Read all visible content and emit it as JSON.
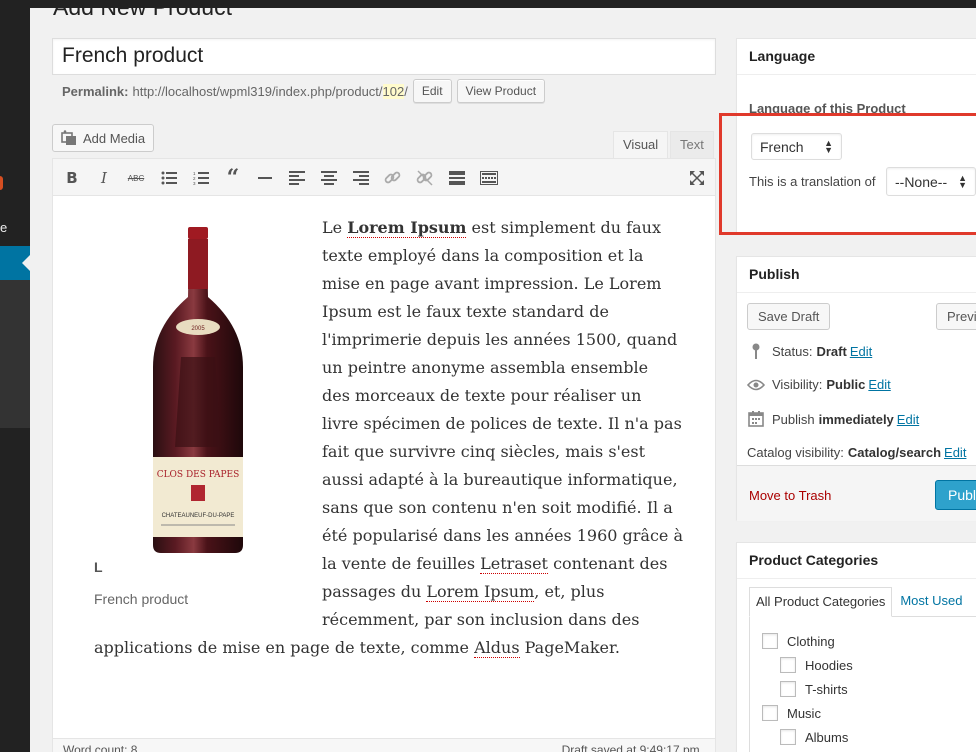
{
  "page": {
    "heading": "Add New Product"
  },
  "title": {
    "value": "French product"
  },
  "permalink": {
    "label": "Permalink:",
    "base": "http://localhost/wpml319/index.php/product/",
    "slug": "102",
    "trail": "/",
    "edit_label": "Edit",
    "view_label": "View Product"
  },
  "editor": {
    "add_media_label": "Add Media",
    "tab_visual": "Visual",
    "tab_text": "Text",
    "toolbar": [
      "bold",
      "italic",
      "strikethrough",
      "bullet-list",
      "numbered-list",
      "blockquote",
      "horizontal-rule",
      "align-left",
      "align-center",
      "align-right",
      "link",
      "unlink",
      "read-more",
      "toolbar-toggle",
      "fullscreen"
    ],
    "caption_letter": "L",
    "caption": "French product",
    "lines": [
      [
        "Le ",
        "Lorem Ipsum",
        " est simplement du faux"
      ],
      "texte employé dans la composition et la",
      "mise en page avant impression. Le Lorem",
      "Ipsum est le faux texte standard de",
      "l'imprimerie depuis les années 1500, quand",
      "un peintre anonyme assembla ensemble",
      "des morceaux de texte pour réaliser un",
      "livre spécimen de polices de texte. Il n'a pas",
      "fait que survivre cinq siècles, mais s'est",
      "aussi adapté à la bureautique informatique,",
      "sans que son contenu n'en soit modifié. Il a",
      "été popularisé dans les années 1960 grâce à",
      [
        "la vente de feuilles ",
        "Letraset",
        " contenant des"
      ],
      [
        "passages du ",
        "Lorem Ipsum",
        ", et, plus"
      ],
      "récemment, par son inclusion dans des",
      [
        "applications de mise en page de texte, comme ",
        "Aldus",
        " PageMaker."
      ]
    ],
    "word_count": "Word count: 8",
    "draft_saved": "Draft saved at 9:49:17 pm."
  },
  "language_box": {
    "title": "Language",
    "label": "Language of this Product",
    "selected_language": "French",
    "translation_label": "This is a translation of",
    "translation_value": "--None--"
  },
  "publish_box": {
    "title": "Publish",
    "save_draft": "Save Draft",
    "preview": "Preview",
    "status_label": "Status:",
    "status_value": "Draft",
    "visibility_label": "Visibility:",
    "visibility_value": "Public",
    "publish_label": "Publish",
    "publish_value": "immediately",
    "catalog_label": "Catalog visibility:",
    "catalog_value": "Catalog/search",
    "edit": "Edit",
    "trash": "Move to Trash",
    "publish_button": "Publish"
  },
  "categories_box": {
    "title": "Product Categories",
    "tab_all": "All Product Categories",
    "tab_most": "Most Used",
    "items": [
      {
        "label": "Clothing",
        "level": 0
      },
      {
        "label": "Hoodies",
        "level": 1
      },
      {
        "label": "T-shirts",
        "level": 1
      },
      {
        "label": "Music",
        "level": 0
      },
      {
        "label": "Albums",
        "level": 1
      }
    ]
  },
  "colors": {
    "accent": "#0074a2",
    "publish_button": "#2ea2cc",
    "highlight_box": "#e0392b",
    "trash": "#aa0000"
  }
}
